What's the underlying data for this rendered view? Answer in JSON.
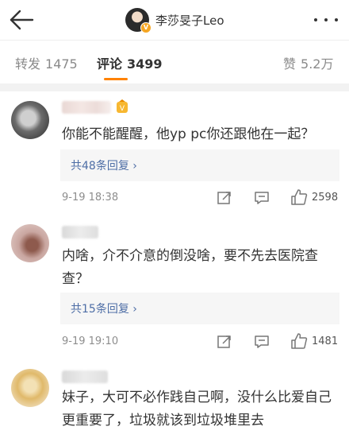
{
  "nav": {
    "back_icon": "arrow-left-icon",
    "title": "李莎旻子Leo",
    "more_icon": "more-dots-icon"
  },
  "tabs": [
    {
      "label": "转发",
      "count": "1475",
      "active": false
    },
    {
      "label": "评论",
      "count": "3499",
      "active": true
    },
    {
      "label": "赞",
      "count": "5.2万",
      "active": false
    }
  ],
  "accent_color": "#ff8200",
  "link_color": "#4e6ea6",
  "comments": [
    {
      "text": "你能不能醒醒，他yp pc你还跟他在一起？",
      "replies": "共48条回复",
      "time": "9-19 18:38",
      "likes": "2598"
    },
    {
      "text": "内啥，介不介意的倒没啥，要不先去医院查查？",
      "replies": "共15条回复",
      "time": "9-19 19:10",
      "likes": "1481"
    },
    {
      "text": "妹子，大可不必作践自己啊，没什么比爱自己更重要了，垃圾就该到垃圾堆里去"
    }
  ]
}
